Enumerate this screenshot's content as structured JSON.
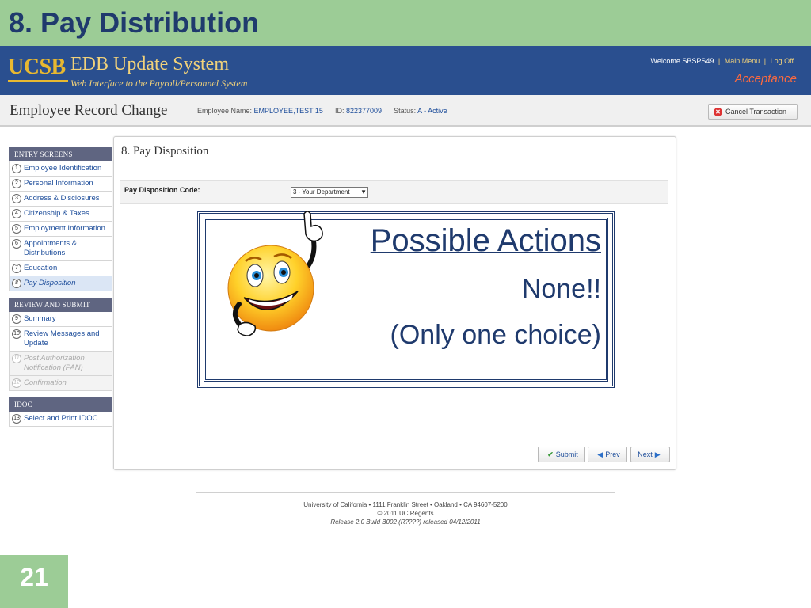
{
  "slide": {
    "title": "8. Pay Distribution",
    "page_number": "21"
  },
  "header": {
    "logo_text": "UCSB",
    "app_name": "EDB Update System",
    "app_subtitle": "Web Interface to the Payroll/Personnel System",
    "welcome": "Welcome SBSPS49",
    "sep": "|",
    "main_menu": "Main Menu",
    "log_off": "Log Off",
    "environment": "Acceptance"
  },
  "subheader": {
    "title": "Employee Record Change",
    "employee_name_label": "Employee Name:",
    "employee_name": "EMPLOYEE,TEST 15",
    "id_label": "ID:",
    "id": "822377009",
    "status_label": "Status:",
    "status": "A - Active",
    "cancel_label": "Cancel Transaction"
  },
  "sidebar": {
    "entry_section": "ENTRY SCREENS",
    "entry_items": [
      {
        "num": "1",
        "label": "Employee Identification"
      },
      {
        "num": "2",
        "label": "Personal Information"
      },
      {
        "num": "3",
        "label": "Address & Disclosures"
      },
      {
        "num": "4",
        "label": "Citizenship & Taxes"
      },
      {
        "num": "5",
        "label": "Employment Information"
      },
      {
        "num": "6",
        "label": "Appointments & Distributions"
      },
      {
        "num": "7",
        "label": "Education"
      },
      {
        "num": "8",
        "label": "Pay Disposition"
      }
    ],
    "review_section": "REVIEW AND SUBMIT",
    "review_items": [
      {
        "num": "9",
        "label": "Summary"
      },
      {
        "num": "10",
        "label": "Review Messages and Update"
      },
      {
        "num": "11",
        "label": "Post Authorization Notification (PAN)"
      },
      {
        "num": "12",
        "label": "Confirmation"
      }
    ],
    "idoc_section": "IDOC",
    "idoc_items": [
      {
        "num": "13",
        "label": "Select and Print IDOC"
      }
    ]
  },
  "main": {
    "panel_title": "8. Pay Disposition",
    "pay_code_label": "Pay Disposition Code:",
    "pay_code_value": "3 - Your Department",
    "submit_label": "Submit",
    "prev_label": "Prev",
    "next_label": "Next"
  },
  "callout": {
    "heading": "Possible Actions",
    "line1": "None!!",
    "line2": "(Only one choice)"
  },
  "footer": {
    "address": "University of California • 1111 Franklin Street • Oakland • CA 94607-5200",
    "copyright": "© 2011 UC Regents",
    "release": "Release 2.0 Build B002 (R????) released 04/12/2011"
  },
  "colors": {
    "slide_green": "#9ccc96",
    "header_blue": "#2a4f8f",
    "title_navy": "#1f3a6d",
    "link_blue": "#1d4d9a",
    "acceptance_orange": "#ff6a3d"
  }
}
